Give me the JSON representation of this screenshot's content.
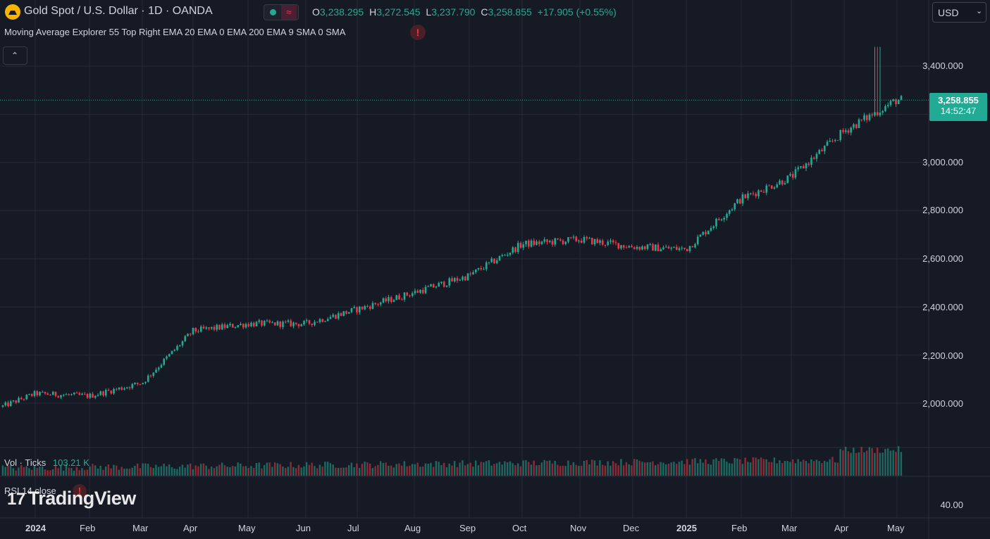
{
  "header": {
    "symbol_title": "Gold Spot / U.S. Dollar · 1D · OANDA",
    "ohlc": {
      "o_label": "O",
      "o_value": "3,238.295",
      "h_label": "H",
      "h_value": "3,272.545",
      "l_label": "L",
      "l_value": "3,237.790",
      "c_label": "C",
      "c_value": "3,258.855",
      "change": "+17.905 (+0.55%)"
    },
    "currency": "USD"
  },
  "indicator_legend": "Moving Average Explorer 55 Top Right EMA 20 EMA 0 EMA 200 EMA 9 SMA 0 SMA",
  "volume_legend": {
    "label": "Vol · Ticks",
    "value": "103.21 K"
  },
  "rsi_legend": "RSI 14 close",
  "watermark": "TradingView",
  "price_axis": [
    "3,400.000",
    "3,000.000",
    "2,800.000",
    "2,600.000",
    "2,400.000",
    "2,200.000",
    "2,000.000"
  ],
  "rsi_axis": "40.00",
  "last_price": {
    "price": "3,258.855",
    "countdown": "14:52:47"
  },
  "time_axis": [
    {
      "label": "2024",
      "bold": true
    },
    {
      "label": "Feb",
      "bold": false
    },
    {
      "label": "Mar",
      "bold": false
    },
    {
      "label": "Apr",
      "bold": false
    },
    {
      "label": "May",
      "bold": false
    },
    {
      "label": "Jun",
      "bold": false
    },
    {
      "label": "Jul",
      "bold": false
    },
    {
      "label": "Aug",
      "bold": false
    },
    {
      "label": "Sep",
      "bold": false
    },
    {
      "label": "Oct",
      "bold": false
    },
    {
      "label": "Nov",
      "bold": false
    },
    {
      "label": "Dec",
      "bold": false
    },
    {
      "label": "2025",
      "bold": true
    },
    {
      "label": "Feb",
      "bold": false
    },
    {
      "label": "Mar",
      "bold": false
    },
    {
      "label": "Apr",
      "bold": false
    },
    {
      "label": "May",
      "bold": false
    }
  ],
  "colors": {
    "up": "#22ab94",
    "down": "#f23645",
    "bg": "#161a25",
    "grid": "#252a36",
    "last": "#22ab94"
  },
  "chart_data": {
    "type": "line",
    "title": "Gold Spot / U.S. Dollar · 1D · OANDA",
    "ylim": [
      1900,
      3500
    ],
    "x": [
      "2024-01",
      "2024-02",
      "2024-03",
      "2024-04",
      "2024-05",
      "2024-06",
      "2024-07",
      "2024-08",
      "2024-09",
      "2024-10",
      "2024-11",
      "2024-12",
      "2025-01",
      "2025-02",
      "2025-03",
      "2025-04",
      "2025-05"
    ],
    "series": [
      {
        "values": [
          2040,
          2030,
          2085,
          2300,
          2330,
          2330,
          2390,
          2460,
          2530,
          2660,
          2680,
          2650,
          2640,
          2850,
          2940,
          3130,
          3260
        ]
      }
    ],
    "grid": true
  }
}
